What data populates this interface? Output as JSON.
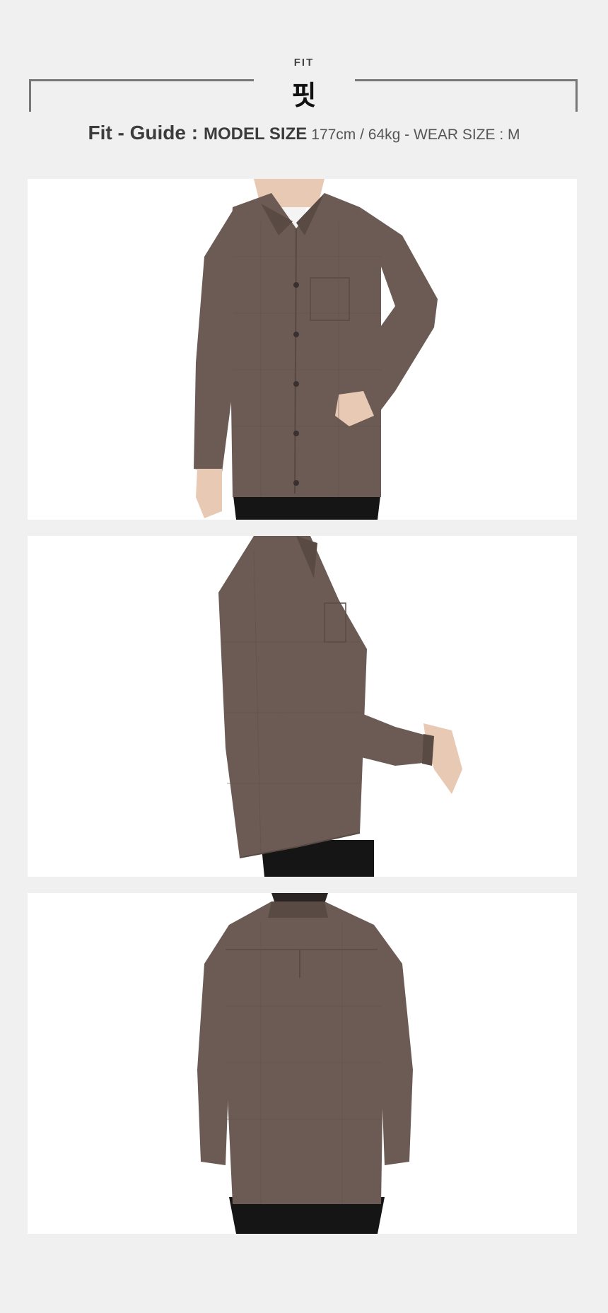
{
  "fit": {
    "eyebrow": "FIT",
    "title": "핏",
    "guide_label": "Fit - Guide :",
    "model_size_label": "MODEL SIZE",
    "model_size_value": "177cm / 64kg - WEAR SIZE : M"
  },
  "photos": [
    {
      "view": "front",
      "shirt_color": "#6b5b54",
      "pants_color": "#151515"
    },
    {
      "view": "side",
      "shirt_color": "#6b5b54",
      "pants_color": "#151515"
    },
    {
      "view": "back",
      "shirt_color": "#6b5b54",
      "pants_color": "#151515"
    }
  ]
}
